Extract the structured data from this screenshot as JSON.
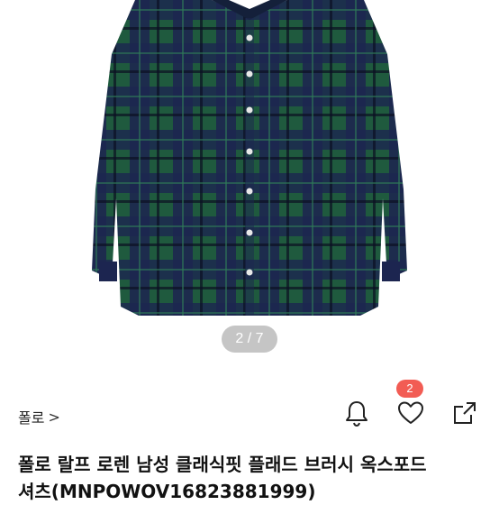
{
  "gallery": {
    "indicator": "2 / 7",
    "image_subject": "green-navy-tartan-shirt"
  },
  "brand": {
    "name": "폴로",
    "chevron": ">"
  },
  "actions": {
    "like_count": "2",
    "icons": [
      "bell-icon",
      "heart-icon",
      "share-icon"
    ]
  },
  "product": {
    "title_line1": "폴로 랄프 로렌 남성 클래식핏 플래드 브러시 옥스포드",
    "title_line2": "셔츠(MNPOWOV16823881999)"
  },
  "colors": {
    "tartan_navy": "#1c2550",
    "tartan_green": "#1f5a3e",
    "badge": "#f25c54"
  }
}
